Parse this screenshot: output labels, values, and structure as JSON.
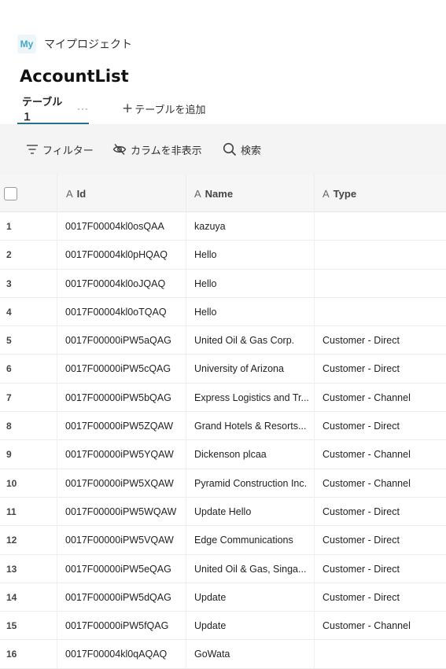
{
  "project": {
    "badge": "My",
    "name": "マイプロジェクト"
  },
  "page_title": "AccountList",
  "tabs": {
    "active_label": "テーブル１",
    "more": "···",
    "add_label": "テーブルを追加",
    "add_icon": "plus-icon"
  },
  "toolbar": {
    "filter_label": "フィルター",
    "hide_label": "カラムを非表示",
    "search_label": "検索"
  },
  "columns": {
    "id": "Id",
    "name": "Name",
    "type": "Type",
    "type_icon": "A"
  },
  "rows": [
    {
      "num": "1",
      "id": "0017F00004kl0osQAA",
      "name": "kazuya",
      "type": ""
    },
    {
      "num": "2",
      "id": "0017F00004kl0pHQAQ",
      "name": "Hello",
      "type": ""
    },
    {
      "num": "3",
      "id": "0017F00004kl0oJQAQ",
      "name": "Hello",
      "type": ""
    },
    {
      "num": "4",
      "id": "0017F00004kl0oTQAQ",
      "name": "Hello",
      "type": ""
    },
    {
      "num": "5",
      "id": "0017F00000iPW5aQAG",
      "name": "United Oil & Gas Corp.",
      "type": "Customer - Direct"
    },
    {
      "num": "6",
      "id": "0017F00000iPW5cQAG",
      "name": "University of Arizona",
      "type": "Customer - Direct"
    },
    {
      "num": "7",
      "id": "0017F00000iPW5bQAG",
      "name": "Express Logistics and Tr...",
      "type": "Customer - Channel"
    },
    {
      "num": "8",
      "id": "0017F00000iPW5ZQAW",
      "name": "Grand Hotels & Resorts...",
      "type": "Customer - Direct"
    },
    {
      "num": "9",
      "id": "0017F00000iPW5YQAW",
      "name": "Dickenson plcaa",
      "type": "Customer - Channel"
    },
    {
      "num": "10",
      "id": "0017F00000iPW5XQAW",
      "name": "Pyramid Construction Inc.",
      "type": "Customer - Channel"
    },
    {
      "num": "11",
      "id": "0017F00000iPW5WQAW",
      "name": "Update Hello",
      "type": "Customer - Direct"
    },
    {
      "num": "12",
      "id": "0017F00000iPW5VQAW",
      "name": "Edge Communications",
      "type": "Customer - Direct"
    },
    {
      "num": "13",
      "id": "0017F00000iPW5eQAG",
      "name": "United Oil & Gas, Singa...",
      "type": "Customer - Direct"
    },
    {
      "num": "14",
      "id": "0017F00000iPW5dQAG",
      "name": "Update",
      "type": "Customer - Direct"
    },
    {
      "num": "15",
      "id": "0017F00000iPW5fQAG",
      "name": "Update",
      "type": "Customer - Channel"
    },
    {
      "num": "16",
      "id": "0017F00004kl0qAQAQ",
      "name": "GoWata",
      "type": ""
    }
  ]
}
